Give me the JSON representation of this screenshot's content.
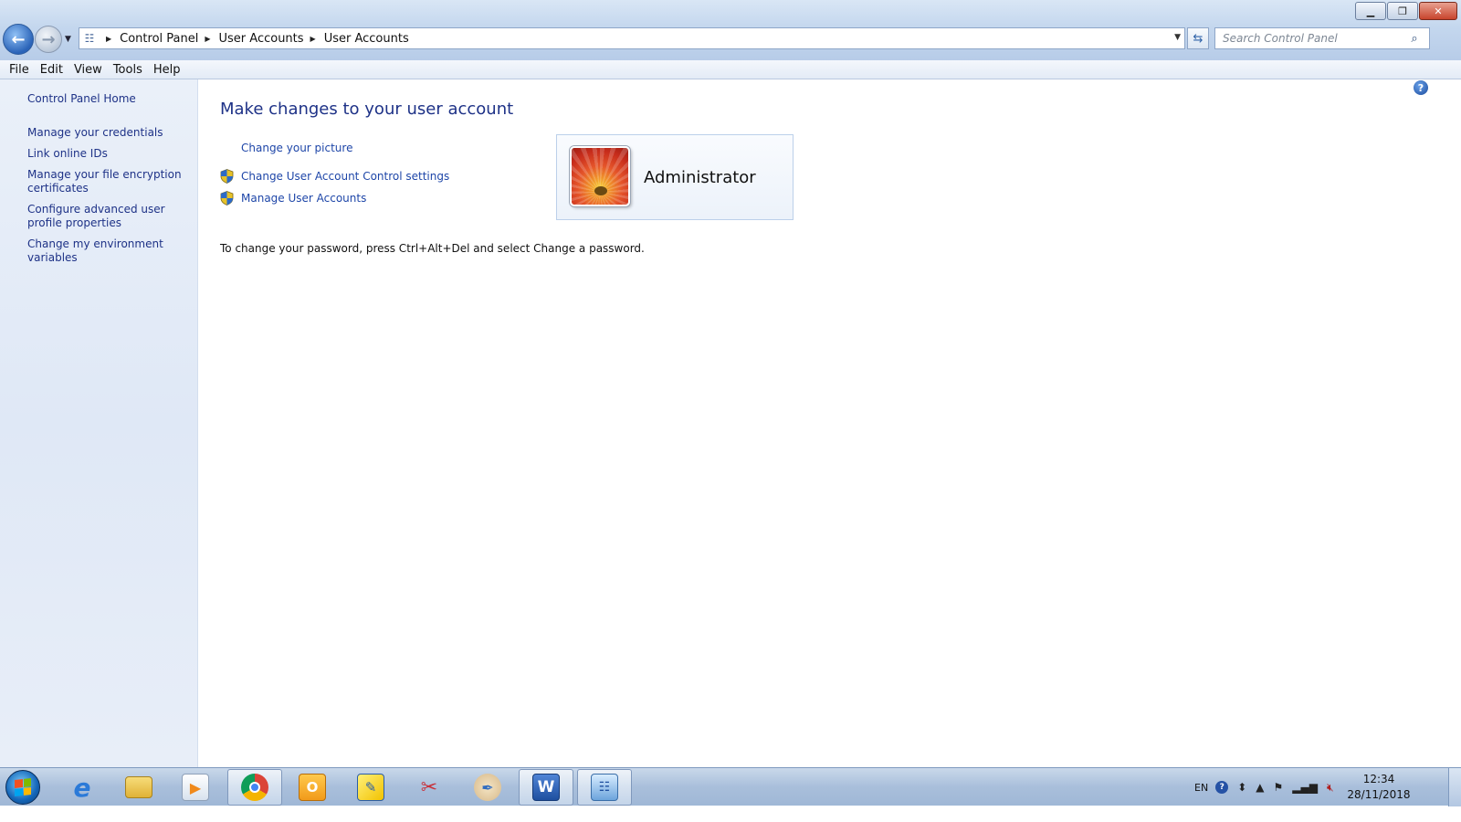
{
  "window": {
    "minimize_icon": "minimize-icon",
    "maximize_icon": "restore-icon",
    "close_icon": "close-icon"
  },
  "address_bar": {
    "breadcrumbs": [
      "Control Panel",
      "User Accounts",
      "User Accounts"
    ],
    "search_placeholder": "Search Control Panel"
  },
  "menu": {
    "items": [
      "File",
      "Edit",
      "View",
      "Tools",
      "Help"
    ]
  },
  "sidebar": {
    "home": "Control Panel Home",
    "links": [
      "Manage your credentials",
      "Link online IDs",
      "Manage your file encryption certificates",
      "Configure advanced user profile properties",
      "Change my environment variables"
    ]
  },
  "main": {
    "title": "Make changes to your user account",
    "tasks": [
      {
        "label": "Change your picture",
        "shield": false
      },
      {
        "label": "Change User Account Control settings",
        "shield": true
      },
      {
        "label": "Manage User Accounts",
        "shield": true
      }
    ],
    "password_note": "To change your password, press Ctrl+Alt+Del and select Change a password.",
    "account": {
      "name": "Administrator"
    }
  },
  "taskbar": {
    "apps": [
      {
        "name": "internet-explorer-icon",
        "active": false
      },
      {
        "name": "file-explorer-icon",
        "active": false
      },
      {
        "name": "media-player-icon",
        "active": false
      },
      {
        "name": "chrome-icon",
        "active": true
      },
      {
        "name": "outlook-icon",
        "active": false
      },
      {
        "name": "sticky-notes-icon",
        "active": false
      },
      {
        "name": "snipping-tool-icon",
        "active": false
      },
      {
        "name": "paint-icon",
        "active": false
      },
      {
        "name": "word-icon",
        "active": true
      },
      {
        "name": "control-panel-icon",
        "active": true
      }
    ],
    "tray": {
      "language": "EN",
      "time": "12:34",
      "date": "28/11/2018"
    }
  },
  "colors": {
    "link": "#1e3287",
    "task_link": "#1e46a8",
    "sidebar_bg": "#e3ebf7"
  }
}
